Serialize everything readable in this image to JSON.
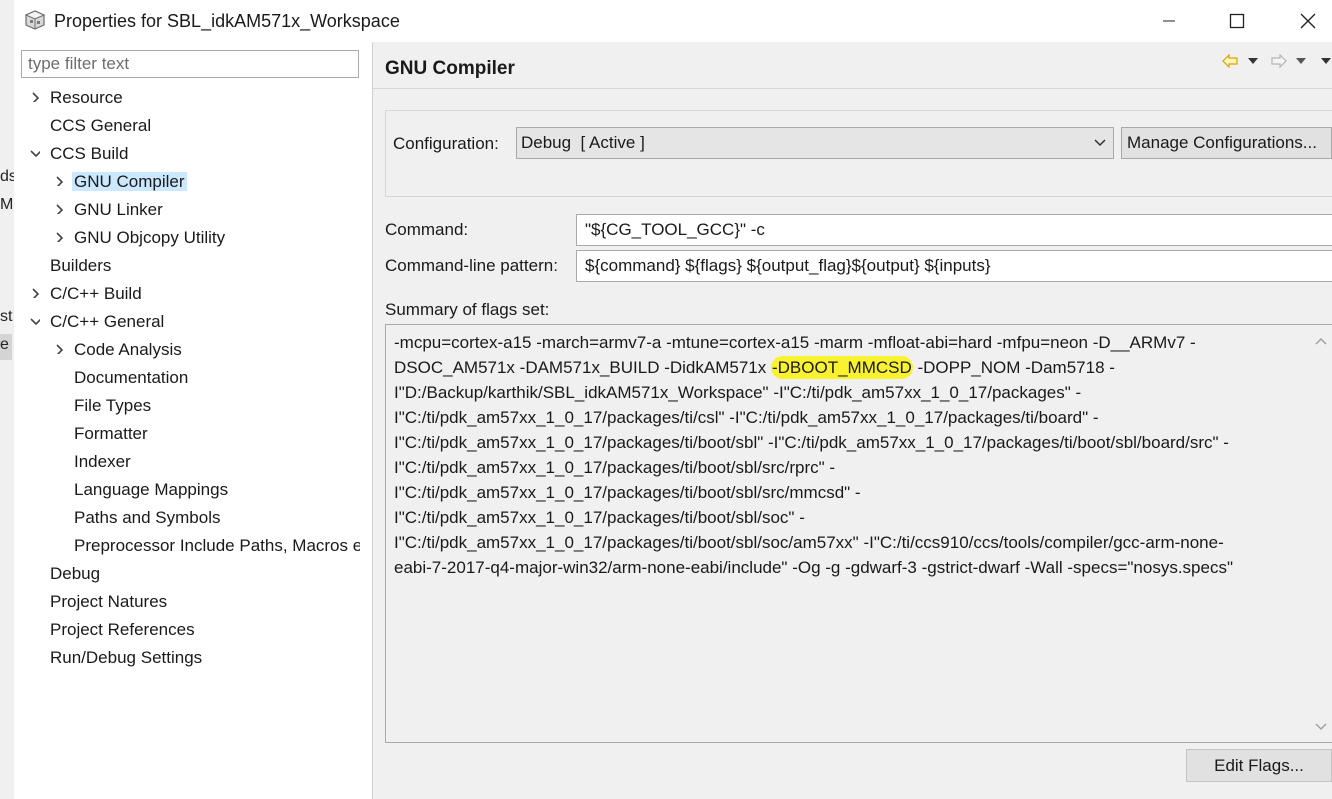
{
  "background_window": {
    "fragments": [
      "ds",
      "M",
      "st",
      "e"
    ]
  },
  "window": {
    "title": "Properties for SBL_idkAM571x_Workspace"
  },
  "filter": {
    "placeholder": "type filter text"
  },
  "tree": [
    {
      "label": "Resource",
      "chevron": "right"
    },
    {
      "label": "CCS General",
      "chevron": ""
    },
    {
      "label": "CCS Build",
      "chevron": "down"
    },
    {
      "label": "GNU Compiler",
      "chevron": "right",
      "selected": true
    },
    {
      "label": "GNU Linker",
      "chevron": "right"
    },
    {
      "label": "GNU Objcopy Utility",
      "chevron": "right"
    },
    {
      "label": "Builders",
      "chevron": ""
    },
    {
      "label": "C/C++ Build",
      "chevron": "right"
    },
    {
      "label": "C/C++ General",
      "chevron": "down"
    },
    {
      "label": "Code Analysis",
      "chevron": "right"
    },
    {
      "label": "Documentation",
      "chevron": ""
    },
    {
      "label": "File Types",
      "chevron": ""
    },
    {
      "label": "Formatter",
      "chevron": ""
    },
    {
      "label": "Indexer",
      "chevron": ""
    },
    {
      "label": "Language Mappings",
      "chevron": ""
    },
    {
      "label": "Paths and Symbols",
      "chevron": ""
    },
    {
      "label": "Preprocessor Include Paths, Macros etc.",
      "chevron": ""
    },
    {
      "label": "Debug",
      "chevron": ""
    },
    {
      "label": "Project Natures",
      "chevron": ""
    },
    {
      "label": "Project References",
      "chevron": ""
    },
    {
      "label": "Run/Debug Settings",
      "chevron": ""
    }
  ],
  "page": {
    "title": "GNU Compiler",
    "configuration_label": "Configuration:",
    "configuration_value": "Debug  [ Active ]",
    "manage_button": "Manage Configurations...",
    "command_label": "Command:",
    "command_value": "\"${CG_TOOL_GCC}\" -c",
    "pattern_label": "Command-line pattern:",
    "pattern_value": "${command} ${flags} ${output_flag}${output} ${inputs}",
    "summary_label": "Summary of flags set:",
    "summary_lines": [
      {
        "before": "-mcpu=cortex-a15 -march=armv7-a -mtune=cortex-a15 -marm -mfloat-abi=hard -mfpu=neon -D__ARMv7 -",
        "highlight": "",
        "after": ""
      },
      {
        "before": "DSOC_AM571x -DAM571x_BUILD -DidkAM571x ",
        "highlight": "-DBOOT_MMCSD",
        "after": " -DOPP_NOM -Dam5718 -"
      },
      {
        "before": "I\"D:/Backup/karthik/SBL_idkAM571x_Workspace\" -I\"C:/ti/pdk_am57xx_1_0_17/packages\" -",
        "highlight": "",
        "after": ""
      },
      {
        "before": "I\"C:/ti/pdk_am57xx_1_0_17/packages/ti/csl\" -I\"C:/ti/pdk_am57xx_1_0_17/packages/ti/board\" -",
        "highlight": "",
        "after": ""
      },
      {
        "before": "I\"C:/ti/pdk_am57xx_1_0_17/packages/ti/boot/sbl\" -I\"C:/ti/pdk_am57xx_1_0_17/packages/ti/boot/sbl/board/src\" -",
        "highlight": "",
        "after": ""
      },
      {
        "before": "I\"C:/ti/pdk_am57xx_1_0_17/packages/ti/boot/sbl/src/rprc\" -",
        "highlight": "",
        "after": ""
      },
      {
        "before": "I\"C:/ti/pdk_am57xx_1_0_17/packages/ti/boot/sbl/src/mmcsd\" -",
        "highlight": "",
        "after": ""
      },
      {
        "before": "I\"C:/ti/pdk_am57xx_1_0_17/packages/ti/boot/sbl/soc\" -",
        "highlight": "",
        "after": ""
      },
      {
        "before": "I\"C:/ti/pdk_am57xx_1_0_17/packages/ti/boot/sbl/soc/am57xx\" -I\"C:/ti/ccs910/ccs/tools/compiler/gcc-arm-none-",
        "highlight": "",
        "after": ""
      },
      {
        "before": "eabi-7-2017-q4-major-win32/arm-none-eabi/include\" -Og -g -gdwarf-3 -gstrict-dwarf -Wall -specs=\"nosys.specs\"",
        "highlight": "",
        "after": ""
      }
    ],
    "edit_flags_button": "Edit Flags..."
  },
  "colors": {
    "selection": "#cce8ff",
    "highlight": "#f9f230",
    "pane_background": "#f0f0f0",
    "nav_arrow": "#e8b400"
  },
  "icons": [
    "app-icon",
    "minimize-icon",
    "maximize-icon",
    "close-icon",
    "chevron-right-icon",
    "chevron-down-icon",
    "back-arrow-icon",
    "forward-arrow-icon",
    "dropdown-caret-icon",
    "view-menu-icon",
    "scroll-up-icon",
    "scroll-down-icon"
  ]
}
